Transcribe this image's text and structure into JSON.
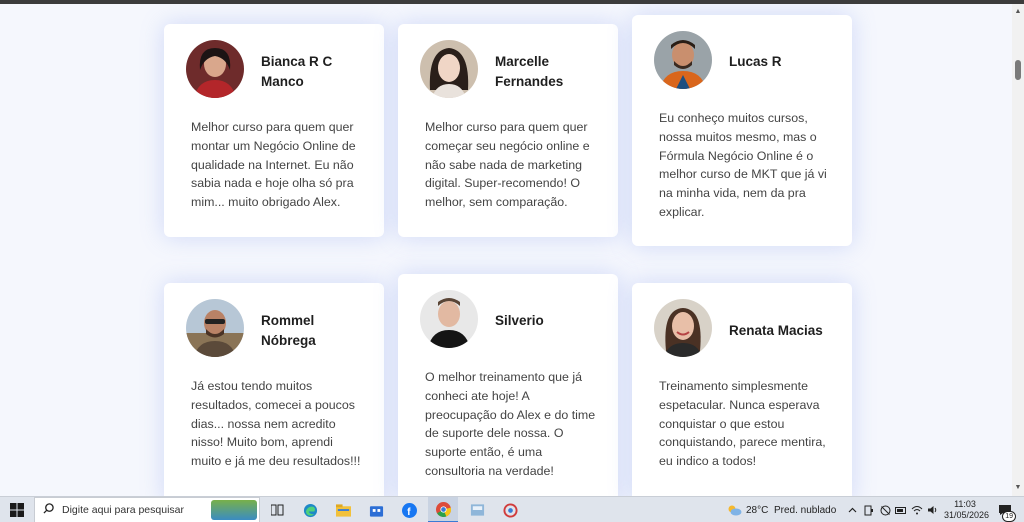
{
  "testimonials": [
    {
      "name": "Bianca R C Manco",
      "quote": "Melhor curso para quem quer montar um Negócio Online de qualidade na Internet. Eu não sabia nada e hoje olha só pra mim... muito obrigado Alex."
    },
    {
      "name": "Marcelle Fernandes",
      "quote": "Melhor curso para quem quer começar seu negócio online e não sabe nada de marketing digital. Super-recomendo! O melhor, sem comparação."
    },
    {
      "name": "Lucas R",
      "quote": "Eu conheço muitos cursos, nossa muitos mesmo, mas o Fórmula Negócio Online é o melhor curso de MKT que já vi na minha vida, nem da pra explicar."
    },
    {
      "name": "Rommel Nóbrega",
      "quote": "Já estou tendo muitos resultados, comecei a poucos dias... nossa nem acredito nisso! Muito bom, aprendi muito e já me deu resultados!!!"
    },
    {
      "name": "Silverio",
      "quote": "O melhor treinamento que já conheci ate hoje! A preocupação do Alex e do time de suporte dele nossa. O suporte então, é uma consultoria na verdade!"
    },
    {
      "name": "Renata Macias",
      "quote": "Treinamento simplesmente espetacular. Nunca esperava conquistar o que estou conquistando, parece mentira, eu indico a todos!"
    }
  ],
  "taskbar": {
    "search_placeholder": "Digite aqui para pesquisar",
    "weather_temp": "28°C",
    "weather_desc": "Pred. nublado",
    "time": "11:03",
    "date": "31/05/2026",
    "notification_count": "19",
    "icons": [
      "windows-start-icon",
      "search-icon",
      "task-view-icon",
      "edge-icon",
      "file-explorer-icon",
      "store-icon",
      "facebook-icon",
      "chrome-icon",
      "app-icon",
      "app-icon-2"
    ]
  },
  "colors": {
    "background": "#f5f7fd",
    "card": "#ffffff",
    "card_glow": "#6e8ceb",
    "name_text": "#1f1f1f",
    "quote_text": "#444444",
    "taskbar": "#dfe4ec"
  }
}
